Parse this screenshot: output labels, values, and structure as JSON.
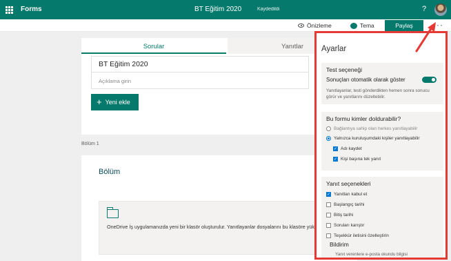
{
  "topbar": {
    "app_name": "Forms",
    "title": "BT Eğitim 2020",
    "save_status": "Kaydedildi",
    "help": "?"
  },
  "commandbar": {
    "preview": "Önizleme",
    "theme": "Tema",
    "share": "Paylaş",
    "more": "···"
  },
  "form": {
    "tabs": {
      "questions": "Sorular",
      "responses": "Yanıtlar"
    },
    "title": "BT Eğitim 2020",
    "description_placeholder": "Açıklama girin",
    "new_button": "Yeni ekle",
    "section_label": "Bölüm 1",
    "section_title": "Bölüm",
    "onedrive_text": "OneDrive İş uygulamanızda yeni bir klasör oluşturulur. Yanıtlayanlar dosyalarını bu klasöre yükleyeb"
  },
  "settings": {
    "title": "Ayarlar",
    "test": {
      "heading": "Test seçeneği",
      "toggle_label": "Sonuçları otomatik olarak göster",
      "help": "Yanıtlayanlar, testi gönderdikten hemen sonra sonucu görür ve yanıtlarını düzeltebilir.",
      "toggle_on": true
    },
    "who": {
      "heading": "Bu formu kimler doldurabilir?",
      "option_link": "Bağlantıya sahip olan herkes yanıtlayabilir",
      "option_org": "Yalnızca kuruluşumdaki kişiler yanıtlayabilir",
      "record_name": "Adı kaydet",
      "one_response": "Kişi başına tek yanıt"
    },
    "response": {
      "heading": "Yanıt seçenekleri",
      "accept": "Yanıtları kabul et",
      "start_date": "Başlangıç tarihi",
      "end_date": "Bitiş tarihi",
      "shuffle": "Soruları karıştır",
      "thanks": "Teşekkür iletisini özelleştirin"
    },
    "notification": {
      "heading": "Bildirim",
      "sub": "Yanıt verenlere e-posta okundu bilgisi"
    }
  },
  "colors": {
    "brand": "#05796b",
    "highlight": "#e53935",
    "checkbox": "#0078d4"
  }
}
